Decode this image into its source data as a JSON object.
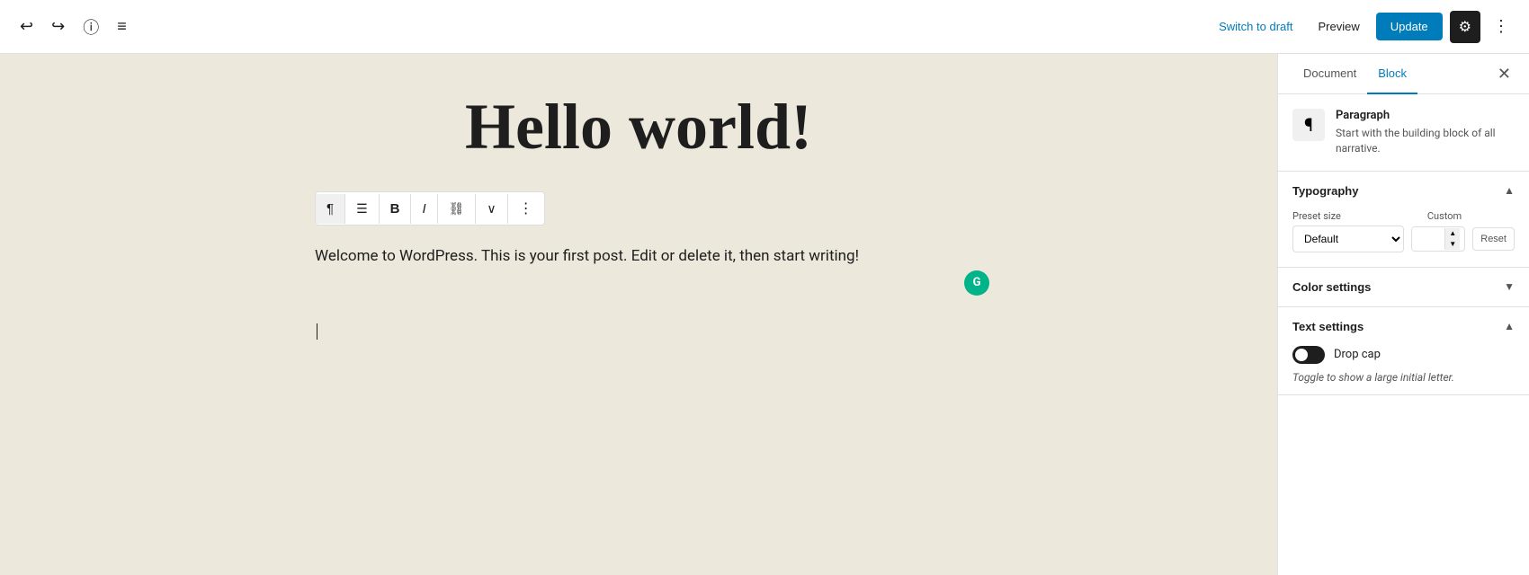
{
  "topbar": {
    "switch_to_draft": "Switch to draft",
    "preview": "Preview",
    "update": "Update",
    "undo_icon": "↩",
    "redo_icon": "↪",
    "info_icon": "ⓘ",
    "list_icon": "≡",
    "settings_icon": "⚙",
    "more_icon": "⋮"
  },
  "editor": {
    "title": "Hello world!",
    "body": "Welcome to WordPress. This is your first post. Edit or delete it, then start writing!",
    "grammarly_icon": "G"
  },
  "format_toolbar": {
    "paragraph_icon": "¶",
    "align_icon": "≡",
    "bold_icon": "B",
    "italic_icon": "I",
    "link_icon": "🔗",
    "more_icon": "∨",
    "options_icon": "⋮"
  },
  "sidebar": {
    "tab_document": "Document",
    "tab_block": "Block",
    "close_icon": "✕",
    "block_name": "Paragraph",
    "block_desc": "Start with the building block of all narrative.",
    "typography_label": "Typography",
    "preset_size_label": "Preset size",
    "custom_label": "Custom",
    "preset_default": "Default",
    "reset_label": "Reset",
    "color_settings_label": "Color settings",
    "text_settings_label": "Text settings",
    "drop_cap_label": "Drop cap",
    "drop_cap_desc": "Toggle to show a large initial letter."
  }
}
